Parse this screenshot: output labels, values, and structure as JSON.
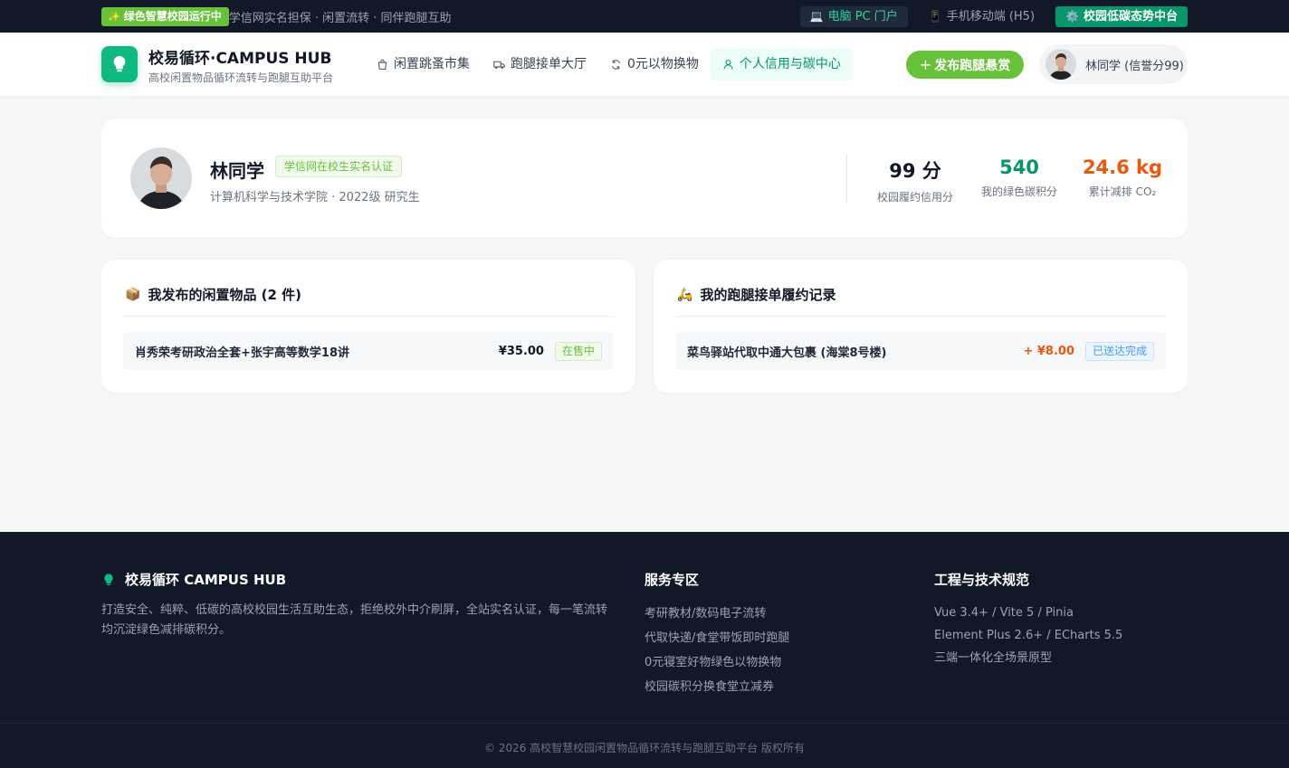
{
  "topbar": {
    "badge": "绿色智慧校园运行中",
    "subtitle": "学信网实名担保 · 闲置流转 · 同伴跑腿互助",
    "links": {
      "pc": "电脑 PC 门户",
      "mobile": "手机移动端 (H5)",
      "eco": "校园低碳态势中台"
    }
  },
  "header": {
    "brand_title": "校易循环·CAMPUS HUB",
    "brand_subtitle": "高校闲置物品循环流转与跑腿互助平台",
    "nav": {
      "market": "闲置跳蚤市集",
      "errand": "跑腿接单大厅",
      "swap": "0元以物换物",
      "credit": "个人信用与碳中心"
    },
    "publish_button": "发布跑腿悬赏",
    "user_chip": "林同学 (信誉分99)"
  },
  "profile": {
    "name": "林同学",
    "verified_tag": "学信网在校生实名认证",
    "department": "计算机科学与技术学院 · 2022级 研究生",
    "stats": {
      "credit_value": "99 分",
      "credit_label": "校园履约信用分",
      "carbon_value": "540",
      "carbon_label": "我的绿色碳积分",
      "co2_value": "24.6 kg",
      "co2_label": "累计减排 CO₂"
    }
  },
  "my_items": {
    "title": "我发布的闲置物品 (2 件)",
    "rows": [
      {
        "name": "肖秀荣考研政治全套+张宇高等数学18讲",
        "price": "¥35.00",
        "status": "在售中"
      }
    ]
  },
  "my_errands": {
    "title": "我的跑腿接单履约记录",
    "rows": [
      {
        "name": "菜鸟驿站代取中通大包裹 (海棠8号楼)",
        "price": "+ ¥8.00",
        "status": "已送达完成"
      }
    ]
  },
  "footer": {
    "brand": "校易循环 CAMPUS HUB",
    "description": "打造安全、纯粹、低碳的高校校园生活互助生态，拒绝校外中介刷屏，全站实名认证，每一笔流转均沉淀绿色减排碳积分。",
    "services": {
      "title": "服务专区",
      "items": [
        "考研教材/数码电子流转",
        "代取快递/食堂带饭即时跑腿",
        "0元寝室好物绿色以物换物",
        "校园碳积分换食堂立减券"
      ]
    },
    "tech": {
      "title": "工程与技术规范",
      "items": [
        "Vue 3.4+ / Vite 5 / Pinia",
        "Element Plus 2.6+ / ECharts 5.5",
        "三端一体化全场景原型"
      ]
    },
    "copyright": "© 2026 高校智慧校园闲置物品循环流转与跑腿互助平台 版权所有"
  },
  "colors": {
    "primary_green": "#10b981",
    "accent_green": "#67c23a",
    "dark": "#111827",
    "orange": "#ea580c",
    "blue": "#409eff"
  }
}
